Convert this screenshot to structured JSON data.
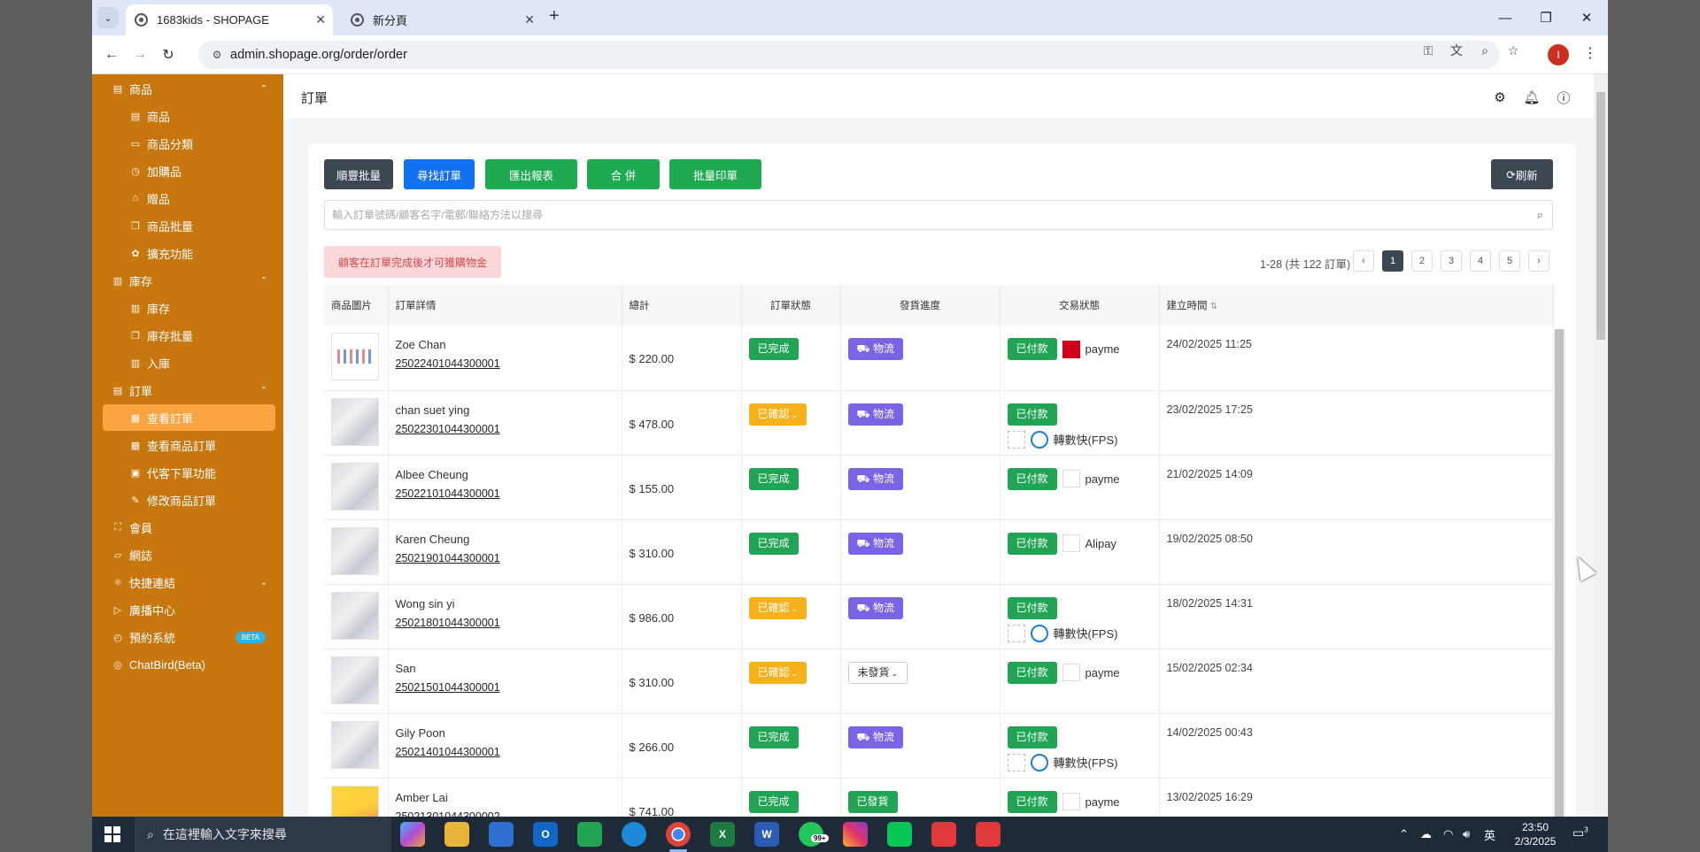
{
  "browser": {
    "tabs": [
      {
        "title": "1683kids - SHOPAGE",
        "active": true
      },
      {
        "title": "新分頁",
        "active": false
      }
    ],
    "url": "admin.shopage.org/order/order",
    "profile_initial": "I"
  },
  "sidebar": {
    "items": [
      {
        "label": "商品",
        "level": "top",
        "icon": "list-icon",
        "caret": "⌃"
      },
      {
        "label": "商品",
        "level": "sub",
        "icon": "list-icon"
      },
      {
        "label": "商品分類",
        "level": "sub",
        "icon": "folder-icon"
      },
      {
        "label": "加購品",
        "level": "sub",
        "icon": "cart-icon"
      },
      {
        "label": "贈品",
        "level": "sub",
        "icon": "gift-icon"
      },
      {
        "label": "商品批量",
        "level": "sub",
        "icon": "copy-icon"
      },
      {
        "label": "擴充功能",
        "level": "sub",
        "icon": "puzzle-icon"
      },
      {
        "label": "庫存",
        "level": "top",
        "icon": "warehouse-icon",
        "caret": "⌃"
      },
      {
        "label": "庫存",
        "level": "sub",
        "icon": "warehouse-icon"
      },
      {
        "label": "庫存批量",
        "level": "sub",
        "icon": "copy-icon"
      },
      {
        "label": "入庫",
        "level": "sub",
        "icon": "warehouse-icon"
      },
      {
        "label": "訂單",
        "level": "top",
        "icon": "order-icon",
        "caret": "⌃"
      },
      {
        "label": "查看訂單",
        "level": "sub",
        "icon": "grid-icon",
        "active": true
      },
      {
        "label": "查看商品訂單",
        "level": "sub",
        "icon": "grid-icon"
      },
      {
        "label": "代客下單功能",
        "level": "sub",
        "icon": "calendar-icon"
      },
      {
        "label": "修改商品訂單",
        "level": "sub",
        "icon": "edit-icon"
      },
      {
        "label": "會員",
        "level": "top",
        "icon": "users-icon"
      },
      {
        "label": "網誌",
        "level": "top",
        "icon": "blog-icon"
      },
      {
        "label": "快捷連結",
        "level": "top",
        "icon": "link-icon",
        "caret": "⌄"
      },
      {
        "label": "廣播中心",
        "level": "top",
        "icon": "broadcast-icon"
      },
      {
        "label": "預約系統",
        "level": "top",
        "icon": "clock-icon",
        "badge": "BETA"
      },
      {
        "label": "ChatBird(Beta)",
        "level": "top",
        "icon": "globe-icon"
      }
    ]
  },
  "header": {
    "title": "訂單"
  },
  "actions": {
    "bulk_sf": "順豐批量",
    "find_order": "尋找訂單",
    "export_report": "匯出報表",
    "merge": "合 併",
    "bulk_print": "批量印單",
    "refresh": "刷新",
    "refresh_icon": "⟳"
  },
  "search": {
    "placeholder": "輸入訂單號碼/顧客名字/電郵/聯絡方法以搜尋"
  },
  "notice": "顧客在訂單完成後才可獲購物金",
  "pagination": {
    "summary": "1-28 (共 122 訂單)",
    "pages": [
      "1",
      "2",
      "3",
      "4",
      "5"
    ],
    "current": "1",
    "prev": "‹",
    "next": "›"
  },
  "table": {
    "headers": {
      "image": "商品圖片",
      "detail": "訂單詳情",
      "total": "總計",
      "status": "訂單狀態",
      "shipping": "發貨進度",
      "payment": "交易狀態",
      "created": "建立時間",
      "sort_icon": "⇅"
    },
    "rows": [
      {
        "name": "Zoe Chan",
        "order_no": "25022401044300001",
        "total": "$ 220.00",
        "status": "已完成",
        "status_color": "#21a456",
        "shipping": "物流",
        "shipping_style": "purple",
        "payment": "已付款",
        "method": "payme",
        "sub": false,
        "created": "24/02/2025 11:25"
      },
      {
        "name": "chan suet ying",
        "order_no": "25022301044300001",
        "total": "$ 478.00",
        "status": "已確認",
        "status_color": "#f7b11a",
        "shipping": "物流",
        "shipping_style": "purple",
        "payment": "已付款",
        "method": "轉數快(FPS)",
        "sub": true,
        "created": "23/02/2025 17:25"
      },
      {
        "name": "Albee Cheung",
        "order_no": "25022101044300001",
        "total": "$ 155.00",
        "status": "已完成",
        "status_color": "#21a456",
        "shipping": "物流",
        "shipping_style": "purple",
        "payment": "已付款",
        "method": "payme",
        "sub": false,
        "created": "21/02/2025 14:09"
      },
      {
        "name": "Karen Cheung",
        "order_no": "25021901044300001",
        "total": "$ 310.00",
        "status": "已完成",
        "status_color": "#21a456",
        "shipping": "物流",
        "shipping_style": "purple",
        "payment": "已付款",
        "method": "Alipay",
        "sub": false,
        "created": "19/02/2025 08:50"
      },
      {
        "name": "Wong sin yi",
        "order_no": "25021801044300001",
        "total": "$ 986.00",
        "status": "已確認",
        "status_color": "#f7b11a",
        "shipping": "物流",
        "shipping_style": "purple",
        "payment": "已付款",
        "method": "轉數快(FPS)",
        "sub": true,
        "created": "18/02/2025 14:31"
      },
      {
        "name": "San",
        "order_no": "25021501044300001",
        "total": "$ 310.00",
        "status": "已確認",
        "status_color": "#f7b11a",
        "shipping": "未發貨",
        "shipping_style": "outline",
        "payment": "已付款",
        "method": "payme",
        "sub": false,
        "created": "15/02/2025 02:34"
      },
      {
        "name": "Gily Poon",
        "order_no": "25021401044300001",
        "total": "$ 266.00",
        "status": "已完成",
        "status_color": "#21a456",
        "shipping": "物流",
        "shipping_style": "purple",
        "payment": "已付款",
        "method": "轉數快(FPS)",
        "sub": true,
        "created": "14/02/2025 00:43"
      },
      {
        "name": "Amber Lai",
        "order_no": "25021301044300002",
        "total": "$ 741.00",
        "status": "已完成",
        "status_color": "#21a456",
        "shipping": "已發貨",
        "shipping_style": "green",
        "payment": "已付款",
        "method": "payme",
        "sub": false,
        "created": "13/02/2025 16:29"
      }
    ]
  },
  "taskbar": {
    "search_placeholder": "在這裡輸入文字來搜尋",
    "time": "23:50",
    "date": "2/3/2025",
    "ime": "英",
    "whatsapp_badge": "99+",
    "notifications": "3"
  },
  "colors": {
    "sidebar": "#c8760e",
    "sidebar_active": "#fba442",
    "primary_dark": "#3d4751",
    "blue": "#1271ee",
    "green": "#1faa52",
    "yellow": "#f7b11a",
    "purple": "#7b63e6"
  }
}
